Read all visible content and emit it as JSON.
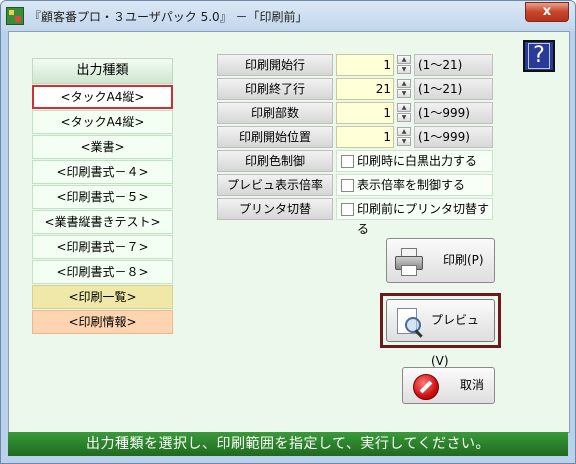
{
  "window": {
    "title": "『顧客番プロ・３ユーザパック 5.0』 －「印刷前」",
    "close_label": "x"
  },
  "help_button": {
    "label": "?"
  },
  "output_types": {
    "header": "出力種類",
    "items": [
      {
        "label": "<タックA4縦>",
        "style": "selected"
      },
      {
        "label": "<タックA4縦>",
        "style": "normal"
      },
      {
        "label": "<業書>",
        "style": "normal"
      },
      {
        "label": "<印刷書式－４>",
        "style": "normal"
      },
      {
        "label": "<印刷書式－５>",
        "style": "normal"
      },
      {
        "label": "<業書縦書きテスト>",
        "style": "normal"
      },
      {
        "label": "<印刷書式－７>",
        "style": "normal"
      },
      {
        "label": "<印刷書式－８>",
        "style": "normal"
      },
      {
        "label": "<印刷一覧>",
        "style": "yellow"
      },
      {
        "label": "<印刷情報>",
        "style": "orange"
      }
    ]
  },
  "settings": {
    "start_row": {
      "label": "印刷開始行",
      "value": "1",
      "range": "(1〜21)"
    },
    "end_row": {
      "label": "印刷終了行",
      "value": "21",
      "range": "(1〜21)"
    },
    "copies": {
      "label": "印刷部数",
      "value": "1",
      "range": "(1〜999)"
    },
    "start_position": {
      "label": "印刷開始位置",
      "value": "1",
      "range": "(1〜999)"
    },
    "color_control": {
      "label": "印刷色制御",
      "option": "印刷時に白黒出力する"
    },
    "preview_zoom": {
      "label": "プレビュ表示倍率",
      "option": "表示倍率を制御する"
    },
    "printer_switch": {
      "label": "プリンタ切替",
      "option": "印刷前にプリンタ切替する"
    }
  },
  "buttons": {
    "print": "印刷(P)",
    "preview": "プレビュ(V)",
    "cancel": "取消"
  },
  "status_bar": {
    "message": "出力種類を選択し、印刷範囲を指定して、実行してください。"
  },
  "colors": {
    "status_bar": "#2a7a2a",
    "client_bg": "#ecf8ec",
    "selected_border": "#d03030",
    "value_bg": "#ffffd8"
  }
}
